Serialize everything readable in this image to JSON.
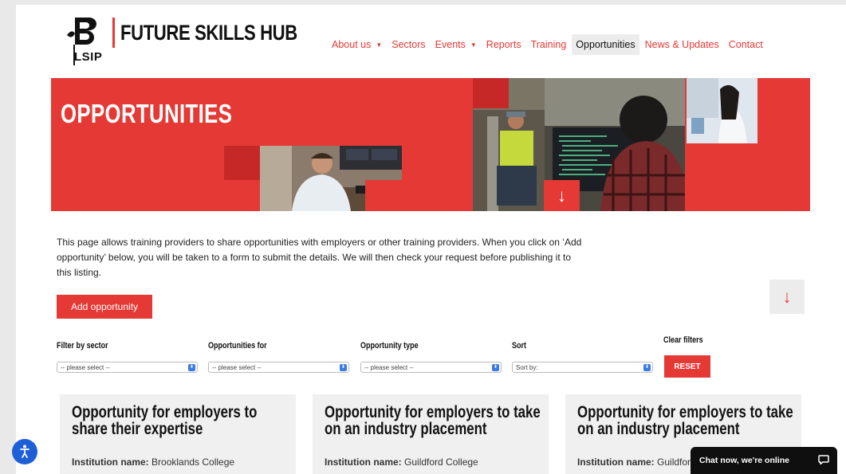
{
  "header": {
    "logo_letters": "B",
    "logo_sub": "LSIP",
    "site_title": "FUTURE SKILLS HUB"
  },
  "nav": {
    "items": [
      {
        "label": "About us",
        "has_dropdown": true
      },
      {
        "label": "Sectors",
        "has_dropdown": false
      },
      {
        "label": "Events",
        "has_dropdown": true
      },
      {
        "label": "Reports",
        "has_dropdown": false
      },
      {
        "label": "Training",
        "has_dropdown": false
      },
      {
        "label": "Opportunities",
        "has_dropdown": false,
        "active": true
      },
      {
        "label": "News & Updates",
        "has_dropdown": false
      },
      {
        "label": "Contact",
        "has_dropdown": false
      }
    ]
  },
  "hero": {
    "title": "OPPORTUNITIES",
    "arrow_icon": "arrow-down-icon"
  },
  "intro": {
    "text": "This page allows training providers to share opportunities with employers or other training providers. When you click on ‘Add opportunity’ below, you will be taken to a form to submit the details. We will then check your request before publishing it to this listing.",
    "button_label": "Add opportunity"
  },
  "filters": {
    "sector": {
      "label": "Filter by sector",
      "value": "-- please select --"
    },
    "for": {
      "label": "Opportunities for",
      "value": "-- please select --"
    },
    "type": {
      "label": "Opportunity type",
      "value": "-- please select --"
    },
    "sort": {
      "label": "Sort",
      "value": "Sort by:"
    },
    "clear_label": "Clear filters",
    "reset_label": "RESET"
  },
  "cards": [
    {
      "title": "Opportunity for employers to share their expertise",
      "inst_label": "Institution name:",
      "inst_value": "Brooklands College"
    },
    {
      "title": "Opportunity for employers to take on an industry placement",
      "inst_label": "Institution name:",
      "inst_value": "Guildford College"
    },
    {
      "title": "Opportunity for employers to take on an industry placement",
      "inst_label": "Institution name:",
      "inst_value": "Guildford College"
    }
  ],
  "chat": {
    "label": "Chat now, we're online"
  },
  "colors": {
    "brand_red": "#e53935",
    "dark_red": "#c62828",
    "accessibility_blue": "#1e5fd8"
  }
}
